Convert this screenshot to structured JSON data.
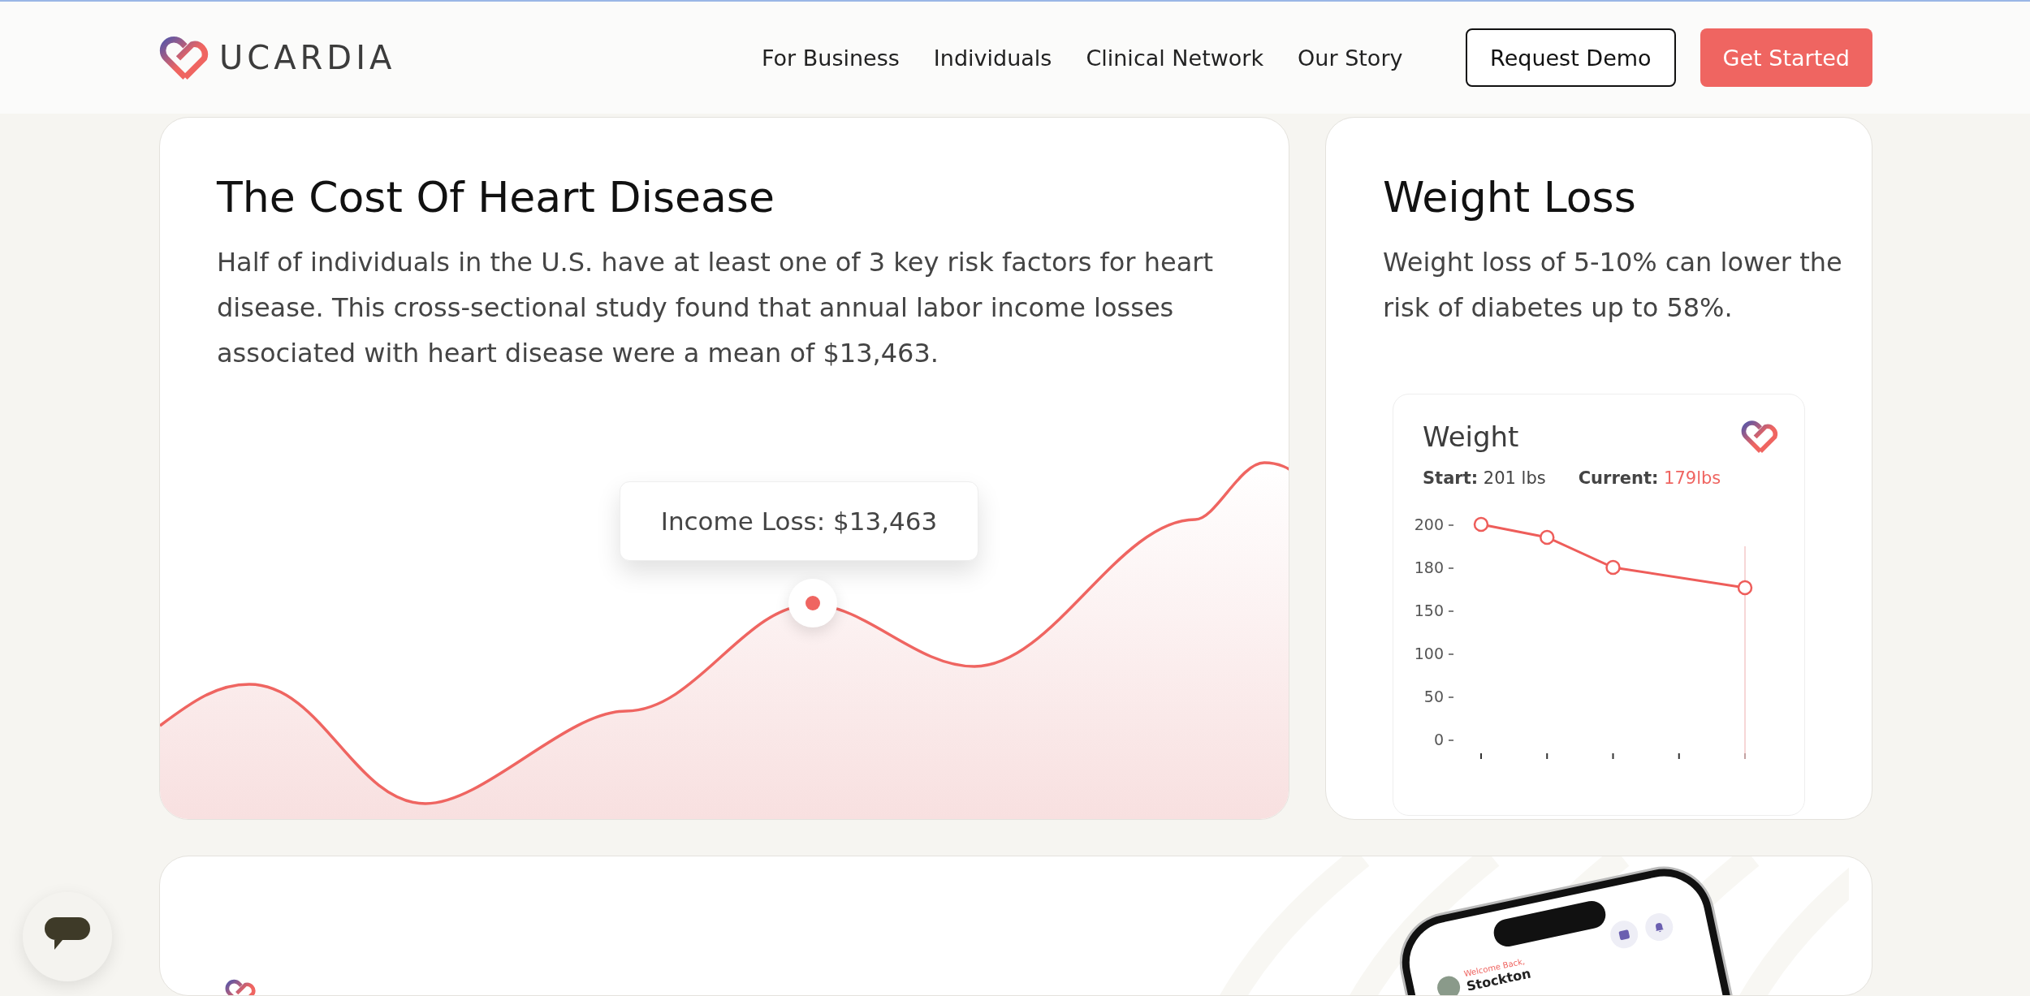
{
  "header": {
    "logo": "UCARDIA",
    "nav": [
      {
        "label": "For Business"
      },
      {
        "label": "Individuals"
      },
      {
        "label": "Clinical Network"
      },
      {
        "label": "Our Story"
      }
    ],
    "buttons": [
      {
        "label": "Request Demo",
        "kind": "outline"
      },
      {
        "label": "Get Started",
        "kind": "filled"
      }
    ]
  },
  "cost_card": {
    "title": "The Cost Of Heart Disease",
    "body": "Half of individuals in the U.S. have at least one of 3 key risk factors for heart disease. This cross-sectional study found that annual labor income losses associated with heart disease were a mean of $13,463.",
    "tooltip": "Income Loss: $13,463"
  },
  "weight_card": {
    "title": "Weight Loss",
    "body": "Weight loss of 5-10% can lower the risk of diabetes up to 58%.",
    "widget": {
      "title": "Weight",
      "start_label": "Start:",
      "start_value": "201 lbs",
      "current_label": "Current:",
      "current_value": "179lbs",
      "axis_labels": [
        "200",
        "180",
        "150",
        "100",
        "50",
        "0"
      ]
    }
  },
  "app_preview": {
    "greeting": "Welcome Back,",
    "name": "Stockton"
  }
}
